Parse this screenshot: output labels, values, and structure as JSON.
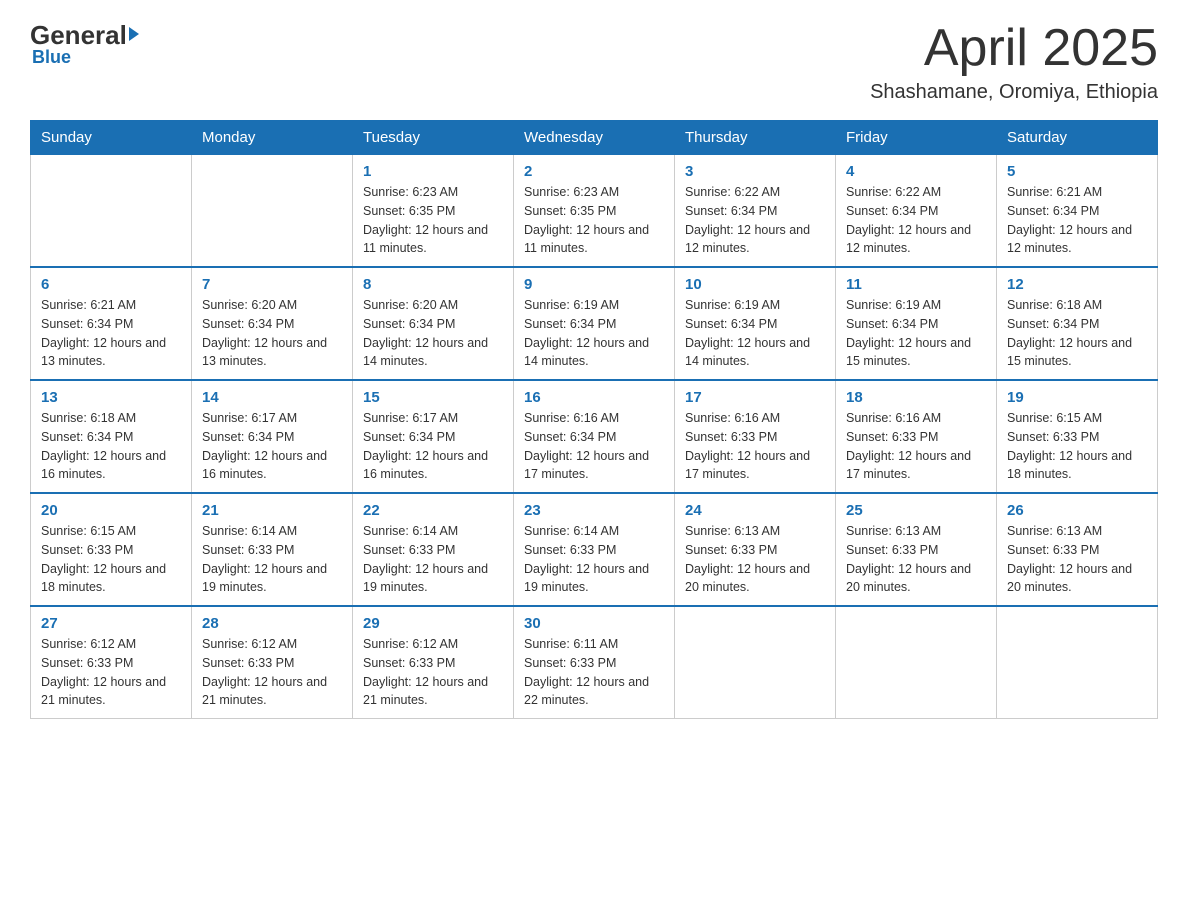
{
  "logo": {
    "general": "General",
    "triangle": "",
    "blue": "Blue"
  },
  "title": "April 2025",
  "subtitle": "Shashamane, Oromiya, Ethiopia",
  "days_of_week": [
    "Sunday",
    "Monday",
    "Tuesday",
    "Wednesday",
    "Thursday",
    "Friday",
    "Saturday"
  ],
  "weeks": [
    [
      {
        "day": "",
        "info": ""
      },
      {
        "day": "",
        "info": ""
      },
      {
        "day": "1",
        "sunrise": "6:23 AM",
        "sunset": "6:35 PM",
        "daylight": "12 hours and 11 minutes."
      },
      {
        "day": "2",
        "sunrise": "6:23 AM",
        "sunset": "6:35 PM",
        "daylight": "12 hours and 11 minutes."
      },
      {
        "day": "3",
        "sunrise": "6:22 AM",
        "sunset": "6:34 PM",
        "daylight": "12 hours and 12 minutes."
      },
      {
        "day": "4",
        "sunrise": "6:22 AM",
        "sunset": "6:34 PM",
        "daylight": "12 hours and 12 minutes."
      },
      {
        "day": "5",
        "sunrise": "6:21 AM",
        "sunset": "6:34 PM",
        "daylight": "12 hours and 12 minutes."
      }
    ],
    [
      {
        "day": "6",
        "sunrise": "6:21 AM",
        "sunset": "6:34 PM",
        "daylight": "12 hours and 13 minutes."
      },
      {
        "day": "7",
        "sunrise": "6:20 AM",
        "sunset": "6:34 PM",
        "daylight": "12 hours and 13 minutes."
      },
      {
        "day": "8",
        "sunrise": "6:20 AM",
        "sunset": "6:34 PM",
        "daylight": "12 hours and 14 minutes."
      },
      {
        "day": "9",
        "sunrise": "6:19 AM",
        "sunset": "6:34 PM",
        "daylight": "12 hours and 14 minutes."
      },
      {
        "day": "10",
        "sunrise": "6:19 AM",
        "sunset": "6:34 PM",
        "daylight": "12 hours and 14 minutes."
      },
      {
        "day": "11",
        "sunrise": "6:19 AM",
        "sunset": "6:34 PM",
        "daylight": "12 hours and 15 minutes."
      },
      {
        "day": "12",
        "sunrise": "6:18 AM",
        "sunset": "6:34 PM",
        "daylight": "12 hours and 15 minutes."
      }
    ],
    [
      {
        "day": "13",
        "sunrise": "6:18 AM",
        "sunset": "6:34 PM",
        "daylight": "12 hours and 16 minutes."
      },
      {
        "day": "14",
        "sunrise": "6:17 AM",
        "sunset": "6:34 PM",
        "daylight": "12 hours and 16 minutes."
      },
      {
        "day": "15",
        "sunrise": "6:17 AM",
        "sunset": "6:34 PM",
        "daylight": "12 hours and 16 minutes."
      },
      {
        "day": "16",
        "sunrise": "6:16 AM",
        "sunset": "6:34 PM",
        "daylight": "12 hours and 17 minutes."
      },
      {
        "day": "17",
        "sunrise": "6:16 AM",
        "sunset": "6:33 PM",
        "daylight": "12 hours and 17 minutes."
      },
      {
        "day": "18",
        "sunrise": "6:16 AM",
        "sunset": "6:33 PM",
        "daylight": "12 hours and 17 minutes."
      },
      {
        "day": "19",
        "sunrise": "6:15 AM",
        "sunset": "6:33 PM",
        "daylight": "12 hours and 18 minutes."
      }
    ],
    [
      {
        "day": "20",
        "sunrise": "6:15 AM",
        "sunset": "6:33 PM",
        "daylight": "12 hours and 18 minutes."
      },
      {
        "day": "21",
        "sunrise": "6:14 AM",
        "sunset": "6:33 PM",
        "daylight": "12 hours and 19 minutes."
      },
      {
        "day": "22",
        "sunrise": "6:14 AM",
        "sunset": "6:33 PM",
        "daylight": "12 hours and 19 minutes."
      },
      {
        "day": "23",
        "sunrise": "6:14 AM",
        "sunset": "6:33 PM",
        "daylight": "12 hours and 19 minutes."
      },
      {
        "day": "24",
        "sunrise": "6:13 AM",
        "sunset": "6:33 PM",
        "daylight": "12 hours and 20 minutes."
      },
      {
        "day": "25",
        "sunrise": "6:13 AM",
        "sunset": "6:33 PM",
        "daylight": "12 hours and 20 minutes."
      },
      {
        "day": "26",
        "sunrise": "6:13 AM",
        "sunset": "6:33 PM",
        "daylight": "12 hours and 20 minutes."
      }
    ],
    [
      {
        "day": "27",
        "sunrise": "6:12 AM",
        "sunset": "6:33 PM",
        "daylight": "12 hours and 21 minutes."
      },
      {
        "day": "28",
        "sunrise": "6:12 AM",
        "sunset": "6:33 PM",
        "daylight": "12 hours and 21 minutes."
      },
      {
        "day": "29",
        "sunrise": "6:12 AM",
        "sunset": "6:33 PM",
        "daylight": "12 hours and 21 minutes."
      },
      {
        "day": "30",
        "sunrise": "6:11 AM",
        "sunset": "6:33 PM",
        "daylight": "12 hours and 22 minutes."
      },
      {
        "day": "",
        "info": ""
      },
      {
        "day": "",
        "info": ""
      },
      {
        "day": "",
        "info": ""
      }
    ]
  ],
  "colors": {
    "header_bg": "#1a6fb3",
    "accent": "#1a6fb3"
  }
}
